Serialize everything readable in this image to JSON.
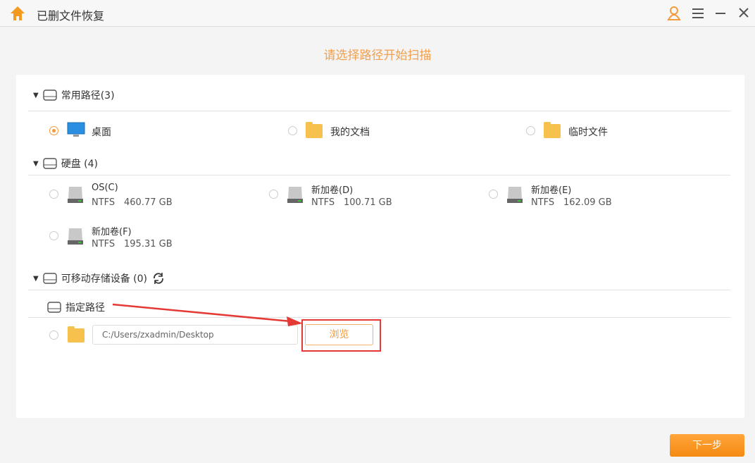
{
  "window": {
    "title": "已删文件恢复"
  },
  "heading": "请选择路径开始扫描",
  "common": {
    "label": "常用路径(3)",
    "items": [
      {
        "label": "桌面",
        "selected": true
      },
      {
        "label": "我的文档",
        "selected": false
      },
      {
        "label": "临时文件",
        "selected": false
      }
    ]
  },
  "disks": {
    "label": "硬盘 (4)",
    "items": [
      {
        "name": "OS(C)",
        "fs": "NTFS",
        "size": "460.77 GB"
      },
      {
        "name": "新加卷(D)",
        "fs": "NTFS",
        "size": "100.71 GB"
      },
      {
        "name": "新加卷(E)",
        "fs": "NTFS",
        "size": "162.09 GB"
      },
      {
        "name": "新加卷(F)",
        "fs": "NTFS",
        "size": "195.31 GB"
      }
    ]
  },
  "removable": {
    "label": "可移动存储设备 (0)"
  },
  "custom": {
    "label": "指定路径",
    "path": "C:/Users/zxadmin/Desktop",
    "browse": "浏览"
  },
  "next": "下一步",
  "colors": {
    "accent": "#f39a3c",
    "annotation": "#e53935"
  }
}
